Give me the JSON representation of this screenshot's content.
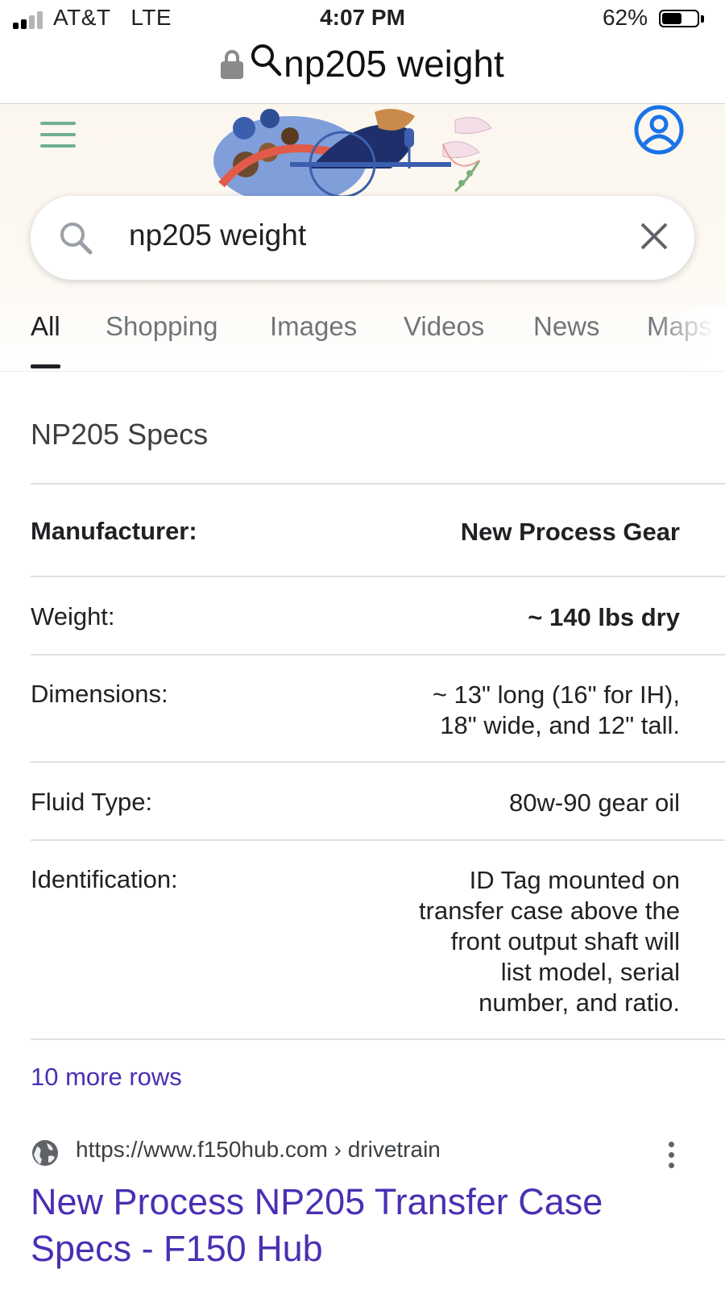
{
  "status_bar": {
    "carrier": "AT&T",
    "network": "LTE",
    "time": "4:07 PM",
    "battery_percent": "62%",
    "battery_level": 0.62
  },
  "browser": {
    "url_text": "np205 weight"
  },
  "search": {
    "query": "np205 weight"
  },
  "tabs": [
    "All",
    "Shopping",
    "Images",
    "Videos",
    "News",
    "Maps"
  ],
  "active_tab": "All",
  "specs": {
    "title": "NP205 Specs",
    "rows": [
      {
        "label": "Manufacturer:",
        "value": [
          "New Process Gear"
        ]
      },
      {
        "label": "Weight:",
        "value": [
          "~ 140 lbs dry"
        ]
      },
      {
        "label": "Dimensions:",
        "value": [
          "~ 13\" long (16\" for IH),",
          "18\" wide, and 12\" tall."
        ]
      },
      {
        "label": "Fluid Type:",
        "value": [
          "80w-90 gear oil"
        ]
      },
      {
        "label": "Identification:",
        "value": [
          "ID Tag mounted on",
          "transfer case above the",
          "front output shaft will",
          "list model, serial",
          "number, and ratio."
        ]
      }
    ],
    "more_rows": "10 more rows"
  },
  "result": {
    "url": "https://www.f150hub.com › drivetrain",
    "title": "New Process NP205 Transfer Case Specs - F150 Hub"
  },
  "colors": {
    "link": "#4b2fb3",
    "menu": "#6fb08e",
    "account": "#1a73e8"
  },
  "icons": [
    "lock-icon",
    "search-icon",
    "menu-icon",
    "account-icon",
    "clear-icon",
    "globe-icon",
    "more-options-icon"
  ]
}
